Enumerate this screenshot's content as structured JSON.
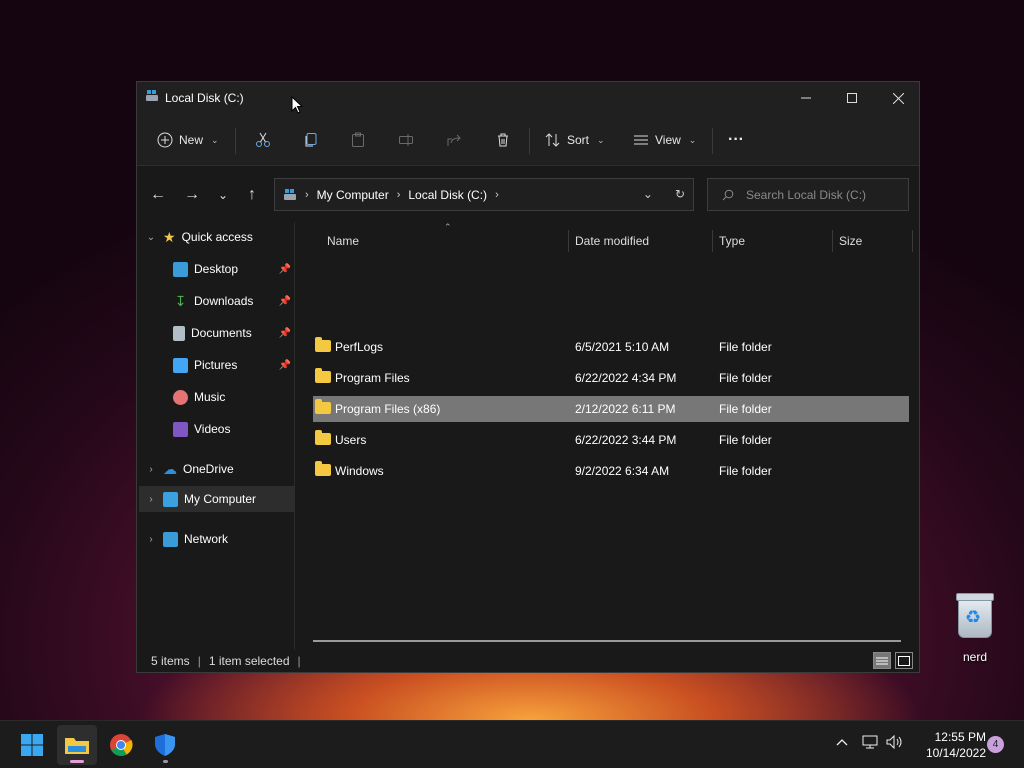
{
  "window": {
    "title": "Local Disk (C:)"
  },
  "toolbar": {
    "new_label": "New",
    "sort_label": "Sort",
    "view_label": "View",
    "more_label": "···"
  },
  "address": {
    "crumbs": [
      "My Computer",
      "Local Disk (C:)"
    ]
  },
  "search": {
    "placeholder": "Search Local Disk (C:)"
  },
  "sidebar": {
    "quick_access": "Quick access",
    "items": [
      {
        "label": "Desktop",
        "icon": "desktop-icon",
        "color": "#3a9bd9"
      },
      {
        "label": "Downloads",
        "icon": "download-icon",
        "color": "#4caf50"
      },
      {
        "label": "Documents",
        "icon": "document-icon",
        "color": "#b0bec5"
      },
      {
        "label": "Pictures",
        "icon": "pictures-icon",
        "color": "#42a5f5"
      },
      {
        "label": "Music",
        "icon": "music-icon",
        "color": "#e57373"
      },
      {
        "label": "Videos",
        "icon": "videos-icon",
        "color": "#7e57c2"
      }
    ],
    "onedrive": "OneDrive",
    "my_computer": "My Computer",
    "network": "Network"
  },
  "columns": {
    "name": "Name",
    "date": "Date modified",
    "type": "Type",
    "size": "Size"
  },
  "files": [
    {
      "name": "PerfLogs",
      "date": "6/5/2021 5:10 AM",
      "type": "File folder"
    },
    {
      "name": "Program Files",
      "date": "6/22/2022 4:34 PM",
      "type": "File folder"
    },
    {
      "name": "Program Files (x86)",
      "date": "2/12/2022 6:11 PM",
      "type": "File folder"
    },
    {
      "name": "Users",
      "date": "6/22/2022 3:44 PM",
      "type": "File folder"
    },
    {
      "name": "Windows",
      "date": "9/2/2022 6:34 AM",
      "type": "File folder"
    }
  ],
  "status": {
    "items": "5 items",
    "selected": "1 item selected"
  },
  "desktop": {
    "recycle_bin_label": "nerd"
  },
  "taskbar": {
    "time": "12:55 PM",
    "date": "10/14/2022",
    "notifications": "4"
  },
  "colors": {
    "accent": "#0078d4",
    "folder": "#f5c842",
    "selection": "#777777"
  }
}
